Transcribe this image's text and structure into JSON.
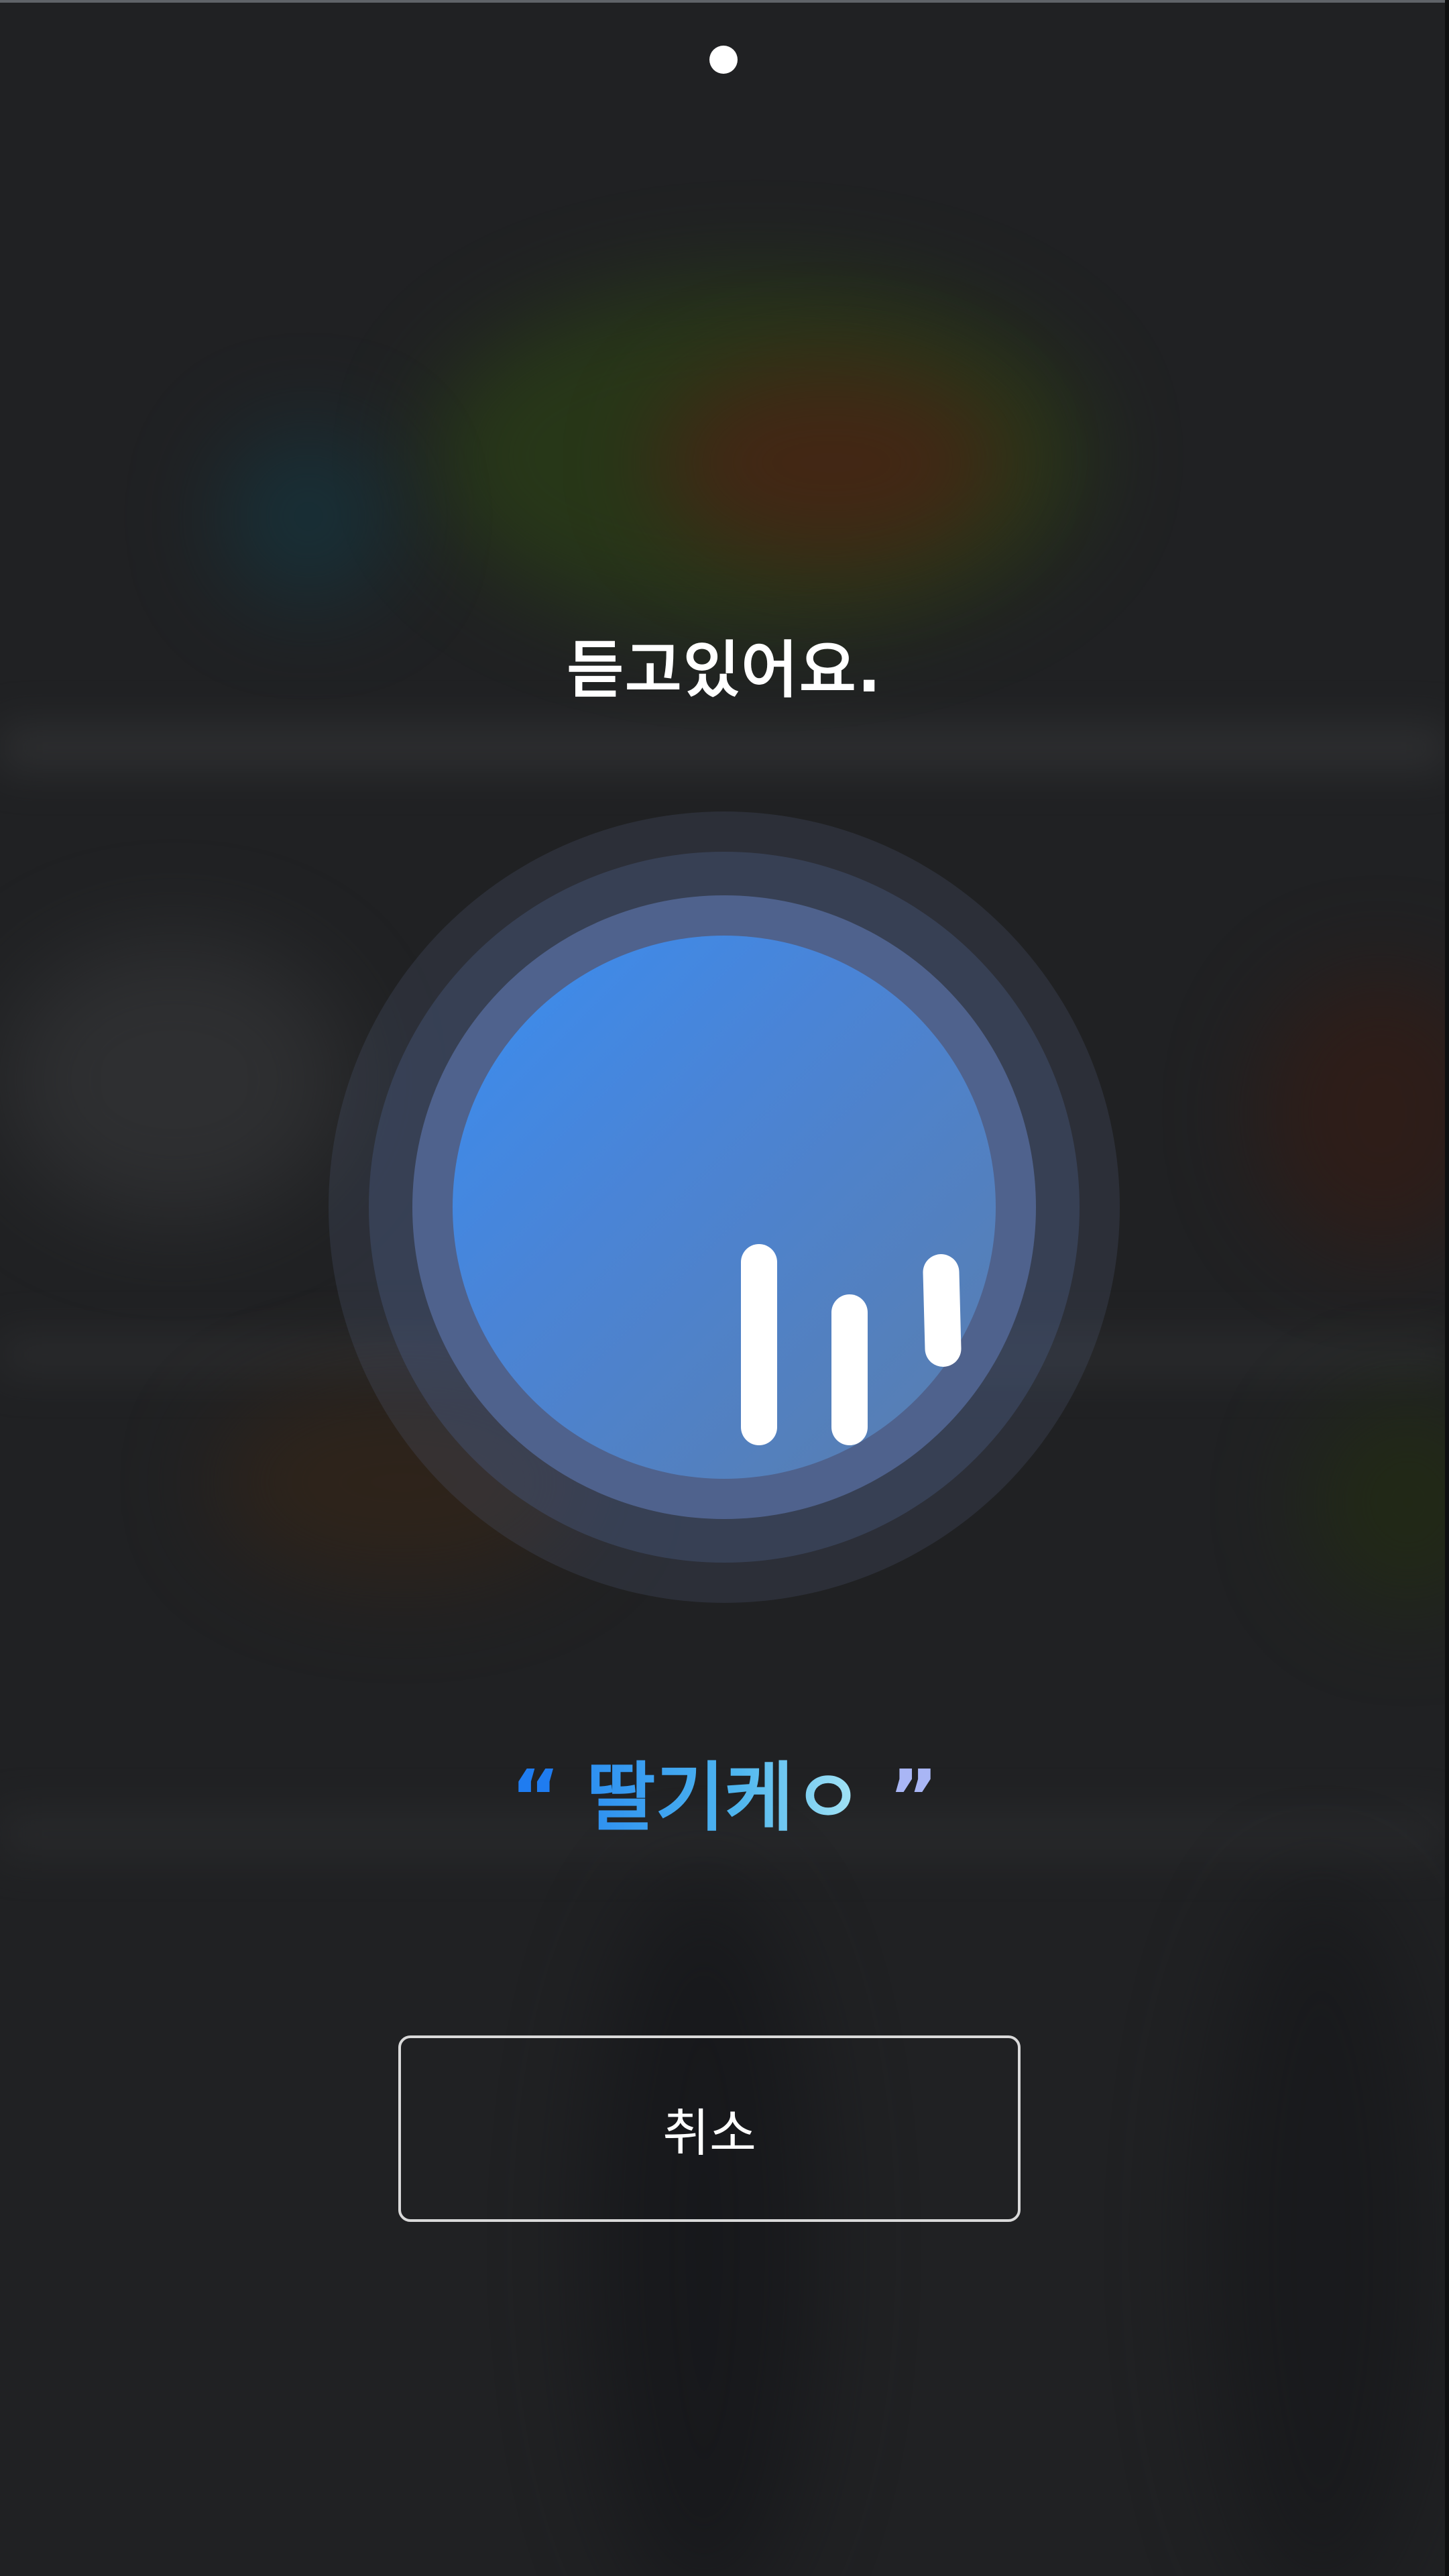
{
  "status": {
    "text": "듣고있어요."
  },
  "transcript": {
    "quote_open": "“",
    "text": "딸기케ㅇ",
    "quote_close": "”"
  },
  "actions": {
    "cancel_label": "취소"
  },
  "mic": {
    "icon": "voice-waveform-icon",
    "state": "listening"
  },
  "colors": {
    "background": "#202123",
    "accent_blue": "#3a8df0",
    "transcript_start": "#2d8ff0",
    "transcript_end": "#a8e6f5"
  }
}
